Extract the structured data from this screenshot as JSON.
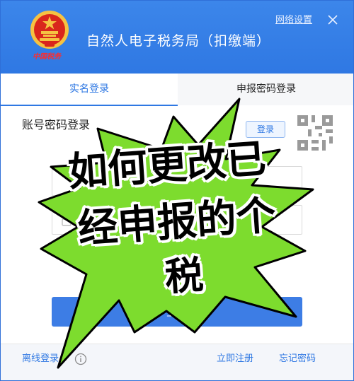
{
  "header": {
    "brand_text": "中国税务",
    "app_title": "自然人电子税务局（扣缴端）",
    "net_settings_label": "网络设置"
  },
  "tabs": [
    {
      "label": "实名登录",
      "active": true
    },
    {
      "label": "申报密码登录",
      "active": false
    }
  ],
  "login": {
    "section_title": "账号密码登录",
    "tag_label": "登录",
    "button_label": "登录"
  },
  "footer": {
    "offline_label": "离线登录",
    "register_label": "立即注册",
    "forgot_label": "忘记密码"
  },
  "overlay": {
    "line1": "如何更改已",
    "line2": "经申报的个",
    "line3": "税"
  },
  "colors": {
    "header_blue": "#2f78e3",
    "starburst_green": "#7ddc2e",
    "emblem_red": "#d9261c",
    "emblem_gold": "#f5c242"
  },
  "icons": [
    "national-emblem-icon",
    "close-icon",
    "qr-code-icon",
    "lock-icon",
    "info-icon"
  ]
}
